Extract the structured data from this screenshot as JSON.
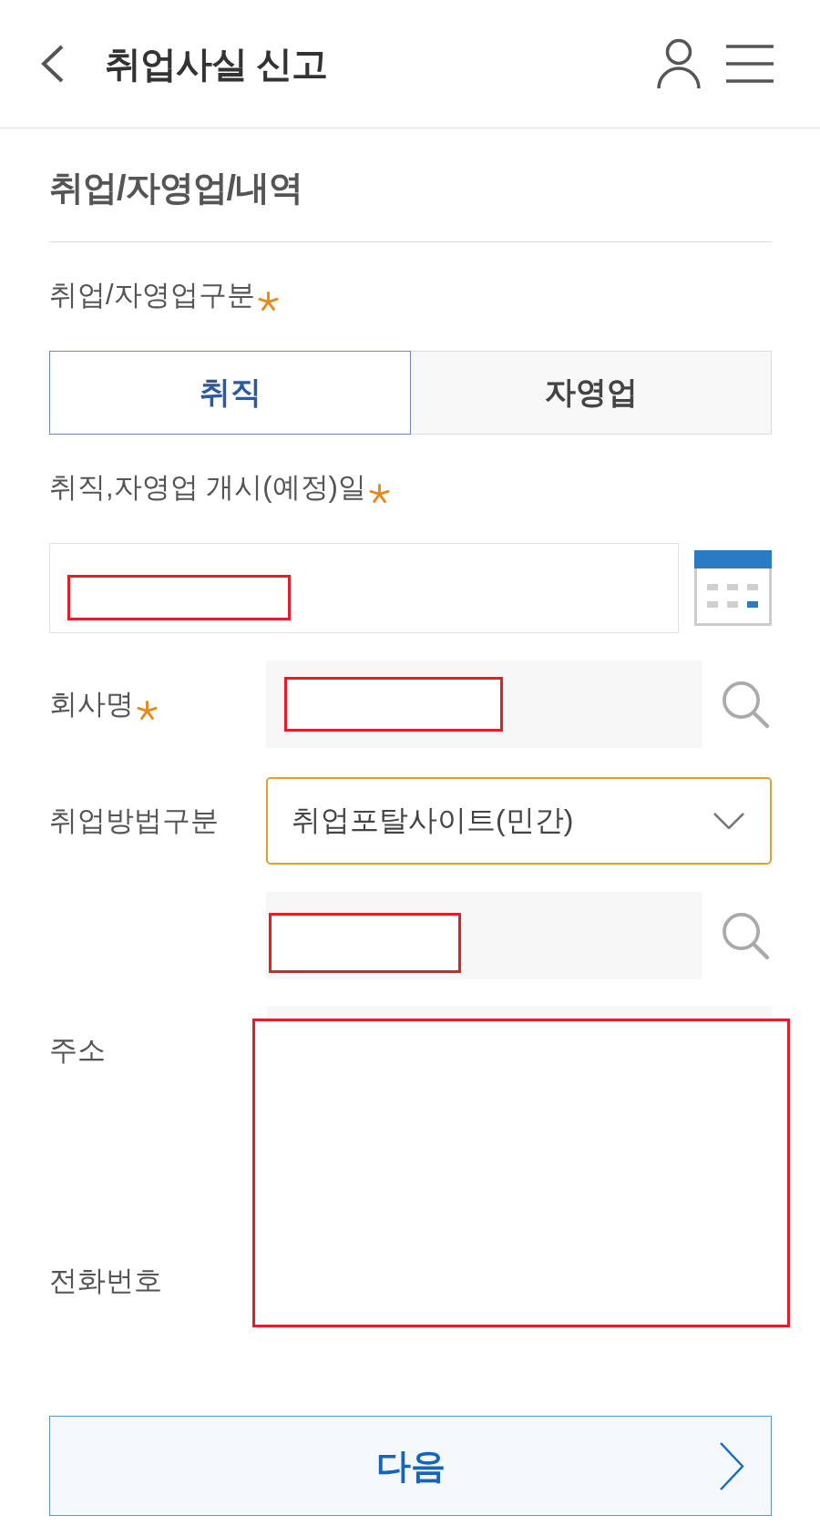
{
  "header": {
    "title": "취업사실 신고"
  },
  "section": {
    "title": "취업/자영업/내역"
  },
  "fields": [
    {
      "kind": "toggle",
      "label": "취업/자영업구분",
      "required": true,
      "options": [
        {
          "label": "취직",
          "selected": true
        },
        {
          "label": "자영업",
          "selected": false
        }
      ]
    },
    {
      "kind": "date",
      "label": "취직,자영업 개시(예정)일",
      "required": true,
      "redacted": true
    },
    {
      "kind": "search",
      "label": "회사명",
      "required": true,
      "redacted": true
    },
    {
      "kind": "select",
      "label": "취업방법구분",
      "required": false,
      "value": "취업포탈사이트(민간)"
    },
    {
      "kind": "search",
      "redacted": true
    }
  ],
  "contact": {
    "redacted": true,
    "rows": [
      {
        "label": "주소"
      },
      {
        "label": "전화번호"
      }
    ]
  },
  "next_button": {
    "label": "다음"
  }
}
